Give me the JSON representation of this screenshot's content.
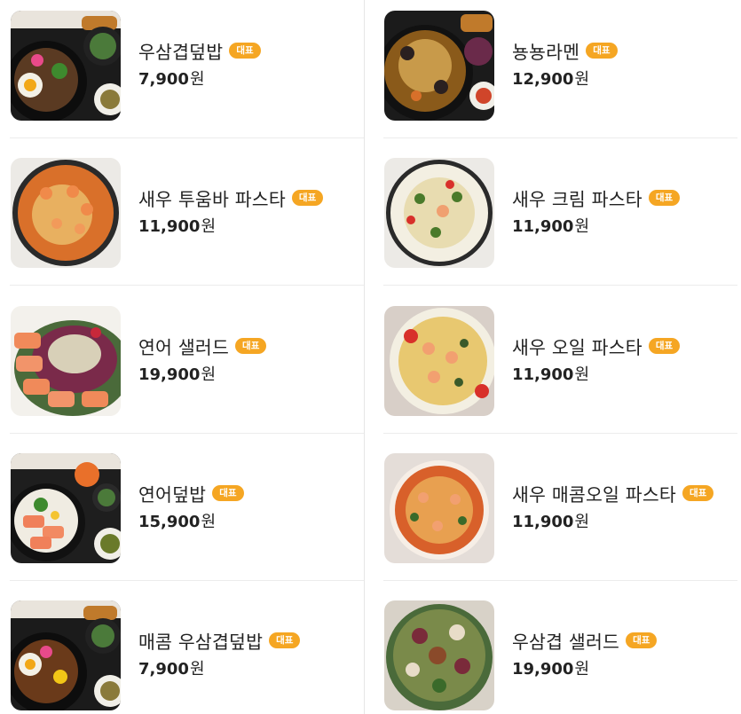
{
  "badge_label": "대표",
  "currency_unit": "원",
  "colors": {
    "badge": "#f5a623",
    "divider": "#e6e6e6"
  },
  "menu": {
    "left": [
      {
        "name": "우삼겹덮밥",
        "price": "7,900"
      },
      {
        "name": "새우 투움바 파스타",
        "price": "11,900"
      },
      {
        "name": "연어 샐러드",
        "price": "19,900"
      },
      {
        "name": "연어덮밥",
        "price": "15,900"
      },
      {
        "name": "매콤 우삼겹덮밥",
        "price": "7,900"
      }
    ],
    "right": [
      {
        "name": "뇽뇽라멘",
        "price": "12,900"
      },
      {
        "name": "새우 크림 파스타",
        "price": "11,900"
      },
      {
        "name": "새우 오일 파스타",
        "price": "11,900"
      },
      {
        "name": "새우 매콤오일 파스타",
        "price": "11,900"
      },
      {
        "name": "우삼겹 샐러드",
        "price": "19,900"
      }
    ]
  }
}
